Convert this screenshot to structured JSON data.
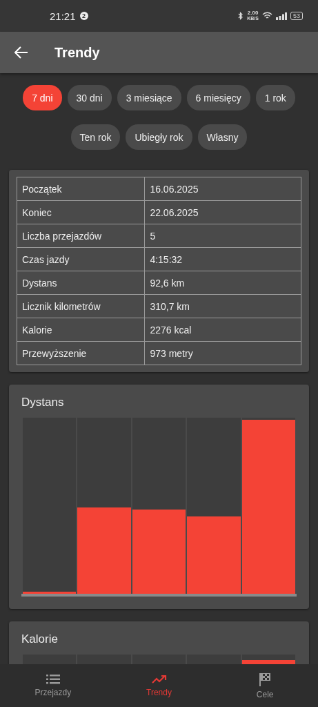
{
  "status_bar": {
    "time": "21:21",
    "notification_count": "2",
    "net_speed": "2.00",
    "net_unit": "KB/S",
    "battery": "53"
  },
  "app_bar": {
    "title": "Trendy"
  },
  "ranges": [
    {
      "label": "7 dni",
      "selected": true
    },
    {
      "label": "30 dni",
      "selected": false
    },
    {
      "label": "3 miesiące",
      "selected": false
    },
    {
      "label": "6 miesięcy",
      "selected": false
    },
    {
      "label": "1 rok",
      "selected": false
    },
    {
      "label": "Ten rok",
      "selected": false
    },
    {
      "label": "Ubiegły rok",
      "selected": false
    },
    {
      "label": "Własny",
      "selected": false
    }
  ],
  "summary": [
    {
      "label": "Początek",
      "value": "16.06.2025"
    },
    {
      "label": "Koniec",
      "value": "22.06.2025"
    },
    {
      "label": "Liczba przejazdów",
      "value": "5"
    },
    {
      "label": "Czas jazdy",
      "value": "4:15:32"
    },
    {
      "label": "Dystans",
      "value": "92,6 km"
    },
    {
      "label": "Licznik kilometrów",
      "value": "310,7 km"
    },
    {
      "label": "Kalorie",
      "value": "2276 kcal"
    },
    {
      "label": "Przewyższenie",
      "value": "973 metry"
    }
  ],
  "charts": [
    {
      "title": "Dystans"
    },
    {
      "title": "Kalorie"
    }
  ],
  "bottom_nav": [
    {
      "label": "Przejazdy",
      "kind": "list",
      "selected": false
    },
    {
      "label": "Trendy",
      "kind": "trend",
      "selected": true
    },
    {
      "label": "Cele",
      "kind": "flag",
      "selected": false
    }
  ]
}
